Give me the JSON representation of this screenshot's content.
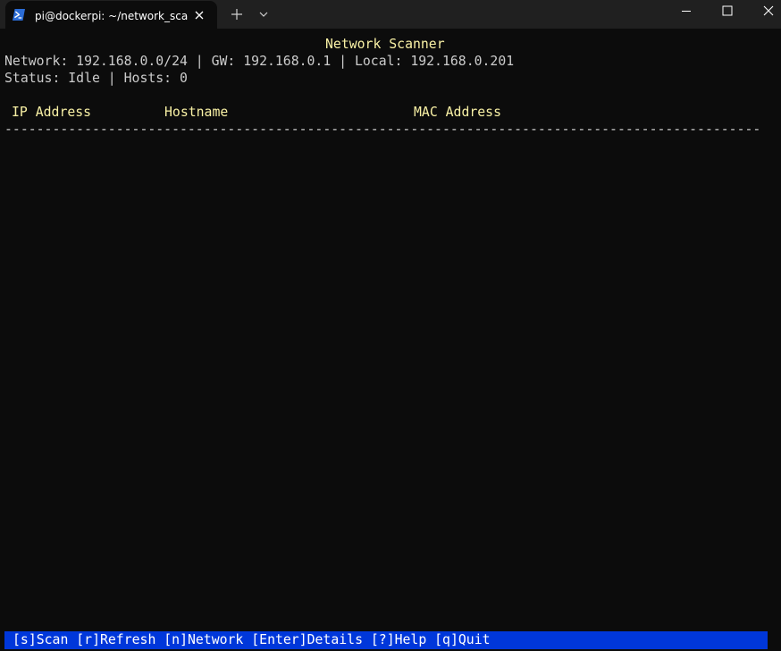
{
  "window": {
    "tab_title": "pi@dockerpi: ~/network_scanner",
    "tab_icon": "powershell-icon"
  },
  "terminal": {
    "app_title": "Network Scanner",
    "network_info": "Network: 192.168.0.0/24 | GW: 192.168.0.1 | Local: 192.168.0.201",
    "status_info": "Status: Idle | Hosts: 0",
    "table": {
      "columns": [
        "IP Address",
        "Hostname",
        "MAC Address"
      ],
      "separator": "-----------------------------------------------------------------------------------------------",
      "rows": []
    },
    "hotkeys": "[s]Scan [r]Refresh [n]Network [Enter]Details [?]Help [q]Quit"
  },
  "colors": {
    "background": "#0c0c0c",
    "titlebar": "#202020",
    "header_text": "#f9f1a5",
    "body_text": "#cccccc",
    "hotkey_bar": "#0037da"
  }
}
